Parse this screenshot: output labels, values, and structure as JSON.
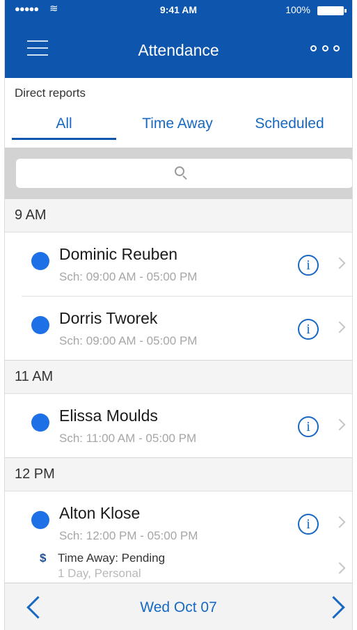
{
  "status": {
    "time": "9:41 AM",
    "battery": "100%"
  },
  "header": {
    "title": "Attendance"
  },
  "subheading": "Direct reports",
  "tabs": [
    {
      "label": "All",
      "active": true
    },
    {
      "label": "Time Away",
      "active": false
    },
    {
      "label": "Scheduled",
      "active": false
    }
  ],
  "search": {
    "placeholder": ""
  },
  "sections": [
    {
      "time": "9 AM",
      "people": [
        {
          "name": "Dominic Reuben",
          "schedule": "Sch: 09:00 AM - 05:00 PM"
        },
        {
          "name": "Dorris Tworek",
          "schedule": "Sch: 09:00 AM - 05:00 PM"
        }
      ]
    },
    {
      "time": "11 AM",
      "people": [
        {
          "name": "Elissa Moulds",
          "schedule": "Sch: 11:00 AM - 05:00 PM"
        }
      ]
    },
    {
      "time": "12 PM",
      "people": [
        {
          "name": "Alton Klose",
          "schedule": "Sch: 12:00 PM - 05:00 PM"
        }
      ]
    }
  ],
  "time_away": {
    "label": "Time Away: Pending",
    "detail": "1 Day, Personal"
  },
  "footer": {
    "date": "Wed Oct 07"
  },
  "colors": {
    "brand": "#0d55ad",
    "accent": "#1768c2",
    "dot": "#1d70e6"
  }
}
